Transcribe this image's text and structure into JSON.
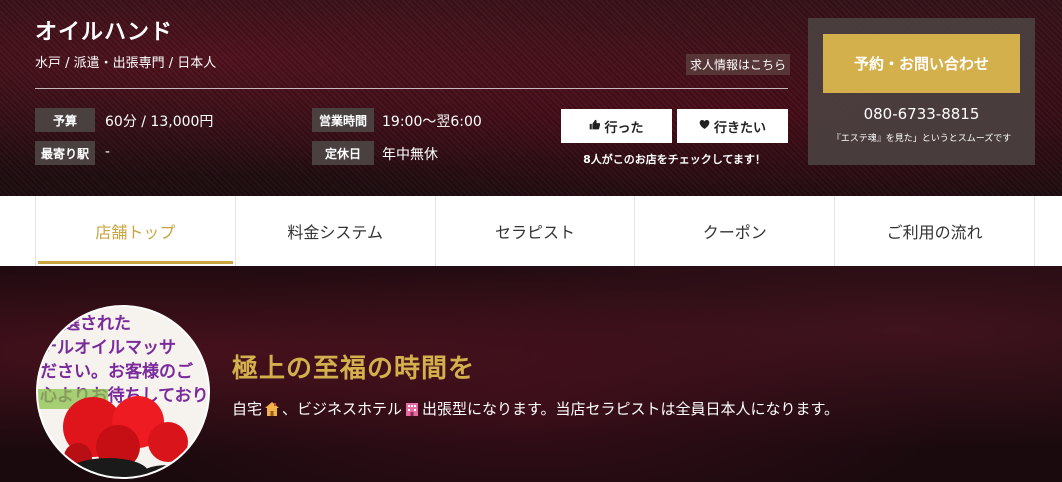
{
  "header": {
    "shop_name": "オイルハンド",
    "shop_sub": "水戸 / 派遣・出張専門 / 日本人",
    "recruit_link": "求人情報はこちら",
    "info": {
      "budget_label": "予算",
      "budget_value": "60分 / 13,000円",
      "station_label": "最寄り駅",
      "station_value": "-",
      "hours_label": "営業時間",
      "hours_value": "19:00〜翌6:00",
      "holiday_label": "定休日",
      "holiday_value": "年中無休"
    },
    "went_label": "行った",
    "want_label": "行きたい",
    "check_text": "8人がこのお店をチェックしてます！",
    "contact": {
      "reserve_label": "予約・お問い合わせ",
      "phone": "080-6733-8815",
      "note": "『エステ魂』を見た」というとスムーズです"
    }
  },
  "nav": {
    "tabs": [
      {
        "label": "店舗トップ"
      },
      {
        "label": "料金システム"
      },
      {
        "label": "セラピスト"
      },
      {
        "label": "クーポン"
      },
      {
        "label": "ご利用の流れ"
      }
    ]
  },
  "hero": {
    "title": "極上の至福の時間を",
    "desc_part1": "自宅",
    "desc_part2": "、ビジネスホテル",
    "desc_part3": "出張型になります。当店セラピストは全員日本人になります。",
    "avatar_text_lines": [
      "厳選された",
      "テルオイルマッサ",
      "ださい。お客様のご",
      "心よりお待ちしており"
    ]
  },
  "colors": {
    "accent_gold": "#d4b04c",
    "nav_active": "#c9a441",
    "tag_bg": "#4a4040"
  },
  "icons": {
    "thumb": "thumbs-up-icon",
    "heart": "heart-icon",
    "house": "house-icon",
    "hotel": "hotel-icon"
  }
}
